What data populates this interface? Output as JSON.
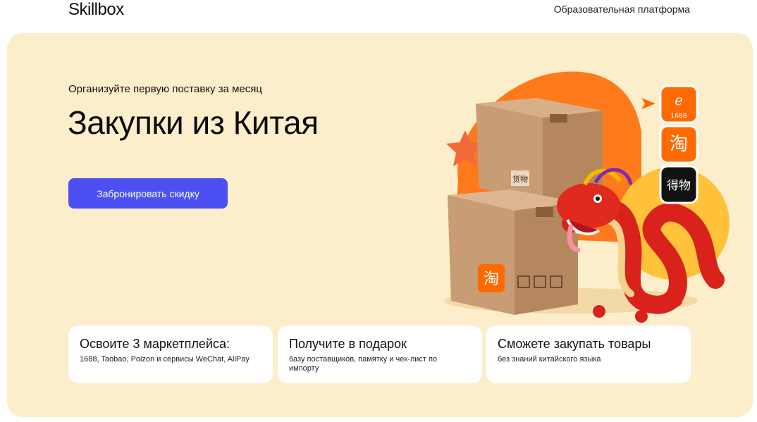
{
  "header": {
    "logo": "Skillbox",
    "platform_link": "Образовательная платформа"
  },
  "hero": {
    "subtitle": "Организуйте первую поставку за месяц",
    "title": "Закупки из Китая",
    "cta_label": "Забронировать скидку",
    "illustration": {
      "box_label": "货物",
      "taobao_glyph": "淘",
      "alibaba_number": "1688",
      "poizon_glyph": "得物"
    }
  },
  "cards": [
    {
      "title": "Освоите 3 маркетплейса:",
      "text": "1688, Taobao, Poizon и сервисы WeChat, AliPay"
    },
    {
      "title": "Получите в подарок",
      "text": "базу поставщиков, памятку и чек-лист по импорту"
    },
    {
      "title": "Сможете закупать товары",
      "text": "без знаний китайского языка"
    }
  ],
  "colors": {
    "hero_bg": "#fdeecb",
    "accent": "#4c4ff2",
    "orange": "#ff6a00"
  }
}
